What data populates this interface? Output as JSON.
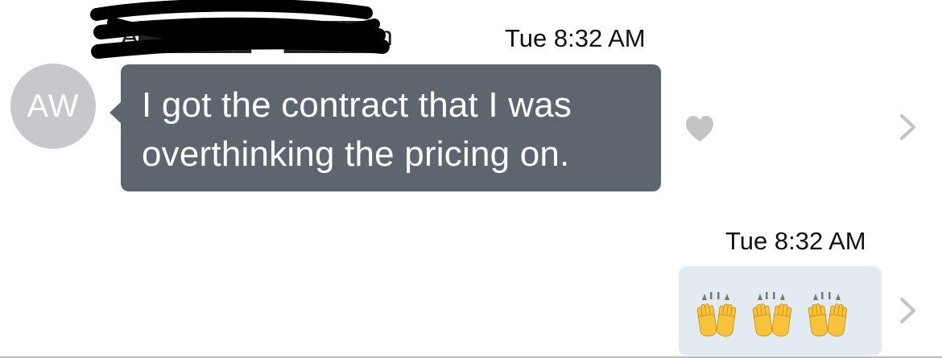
{
  "conversation": {
    "incoming": {
      "sender_name": "A██████ W█████n",
      "timestamp": "Tue 8:32 AM",
      "avatar_initials": "AW",
      "message_line_1": "I got the contract that I was",
      "message_line_2": "overthinking the pricing on.",
      "reaction_icon": "heart-icon"
    },
    "outgoing": {
      "timestamp": "Tue 8:32 AM",
      "content": "🙌🙌🙌",
      "content_icon": "raised-hands-emoji"
    },
    "row_action_icon": "chevron-right-icon"
  },
  "colors": {
    "incoming_bubble": "#5d656e",
    "outgoing_bubble": "#e2eaf2",
    "avatar_bg": "#c8c7cc",
    "heart": "#c4c4c4",
    "chevron": "#c4c4c8",
    "emoji_yellow": "#f7c23c"
  }
}
